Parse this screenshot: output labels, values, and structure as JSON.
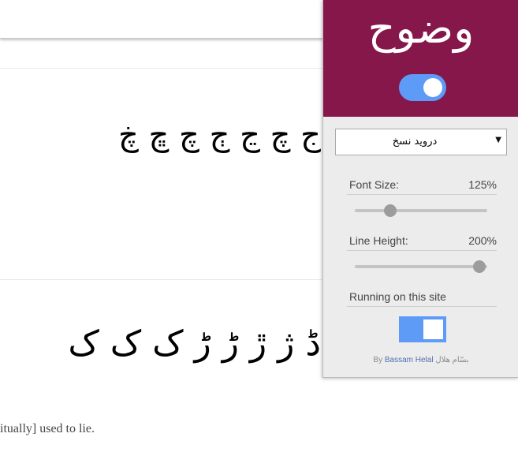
{
  "page": {
    "arabic_row_1": "ج چ ڃ ڄ چ ڇ ڿ",
    "arabic_row_2": "ڈ ژ ڙ ڑ ڑ ک ک ک",
    "sentence": "itually] used to lie."
  },
  "popup": {
    "title": "وضوح",
    "enabled": true,
    "font_select": {
      "value": "درويد نسخ"
    },
    "font_size": {
      "label": "Font Size:",
      "value": "125%",
      "slider_fraction": 0.27
    },
    "line_height": {
      "label": "Line Height:",
      "value": "200%",
      "slider_fraction": 0.94
    },
    "running": {
      "label": "Running on this site",
      "enabled": true
    },
    "credit": {
      "prefix": "By ",
      "author": "Bassam Helal",
      "arabic": "بسّام هلال"
    }
  },
  "colors": {
    "header": "#86174a",
    "toggle": "#5d9bf7",
    "panel": "#ececec"
  },
  "icons": {
    "select_arrow": "chevron-down-icon"
  }
}
